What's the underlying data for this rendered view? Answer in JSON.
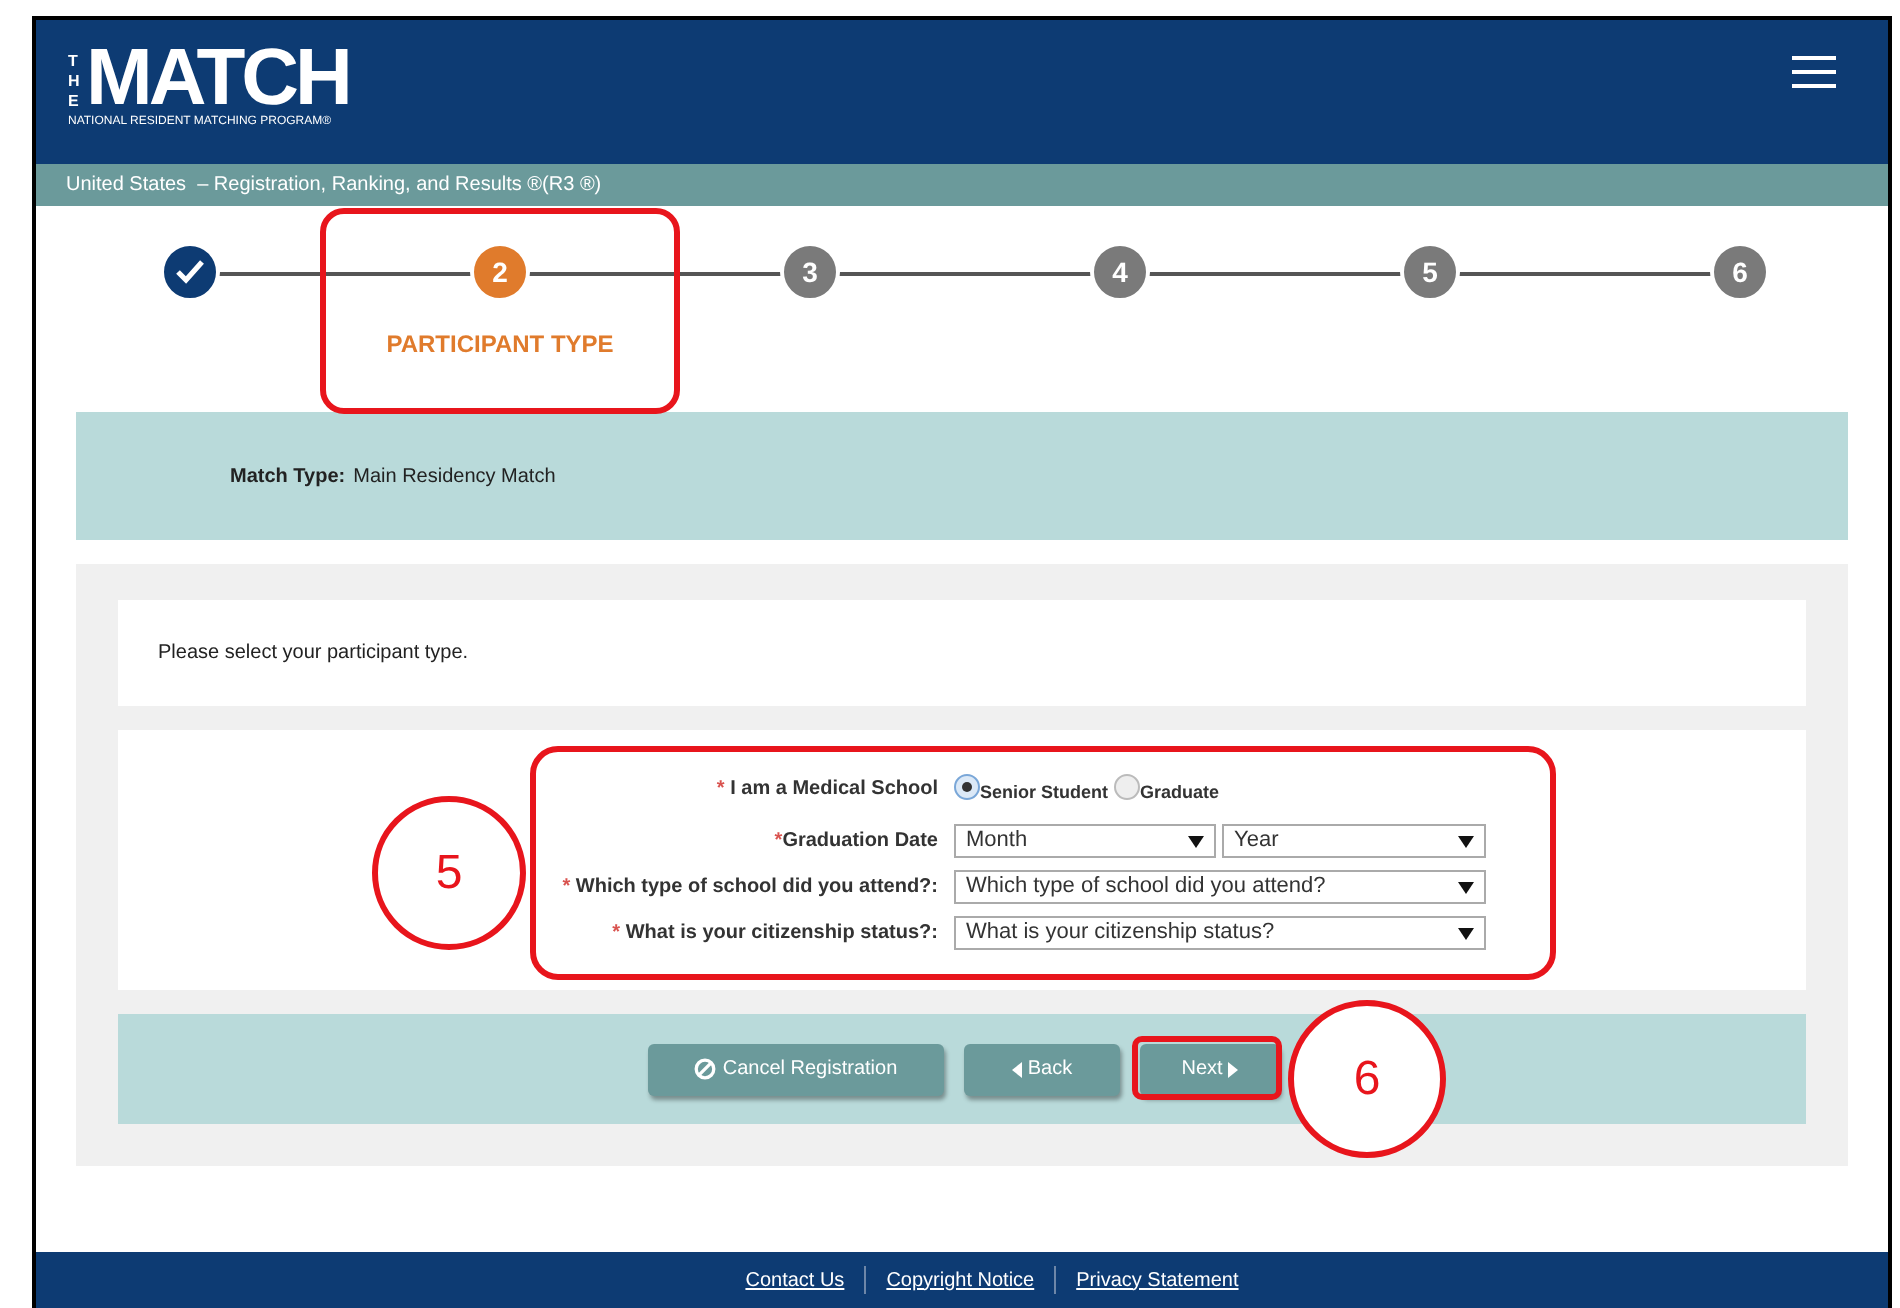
{
  "logo": {
    "the": "THE",
    "name": "MATCH",
    "tagline": "NATIONAL RESIDENT MATCHING PROGRAM®"
  },
  "breadcrumb": "United States  – Registration, Ranking, and Results ®(R3 ®)",
  "steps": [
    {
      "completed": true,
      "selected": false
    },
    {
      "number": "2",
      "label": "PARTICIPANT TYPE",
      "completed": false,
      "selected": true
    },
    {
      "number": "3",
      "completed": false,
      "selected": false
    },
    {
      "number": "4",
      "completed": false,
      "selected": false
    },
    {
      "number": "5",
      "completed": false,
      "selected": false
    },
    {
      "number": "6",
      "completed": false,
      "selected": false
    }
  ],
  "match_type": {
    "label": "Match Type:",
    "value": "Main Residency Match"
  },
  "instruction": "Please select your participant type.",
  "form": {
    "medical_school": {
      "required_mark": "*",
      "label": "I am a Medical School",
      "options": [
        {
          "label": "Senior Student",
          "selected": true
        },
        {
          "label": "Graduate",
          "selected": false
        }
      ]
    },
    "graduation_date": {
      "required_mark": "*",
      "label": "Graduation Date",
      "month": "Month",
      "year": "Year"
    },
    "school_type": {
      "required_mark": "*",
      "label": "Which type of school did you attend?:",
      "value": "Which type of school did you attend?"
    },
    "citizenship": {
      "required_mark": "*",
      "label": "What is your citizenship status?:",
      "value": "What is your citizenship status?"
    }
  },
  "buttons": [
    {
      "kind": "cancel",
      "label": "Cancel Registration"
    },
    {
      "kind": "back",
      "label": "Back"
    },
    {
      "kind": "next",
      "label": "Next"
    }
  ],
  "footer_links": [
    "Contact Us",
    "Copyright Notice",
    "Privacy Statement"
  ],
  "callouts": [
    {
      "number": "5"
    },
    {
      "number": "6"
    }
  ]
}
